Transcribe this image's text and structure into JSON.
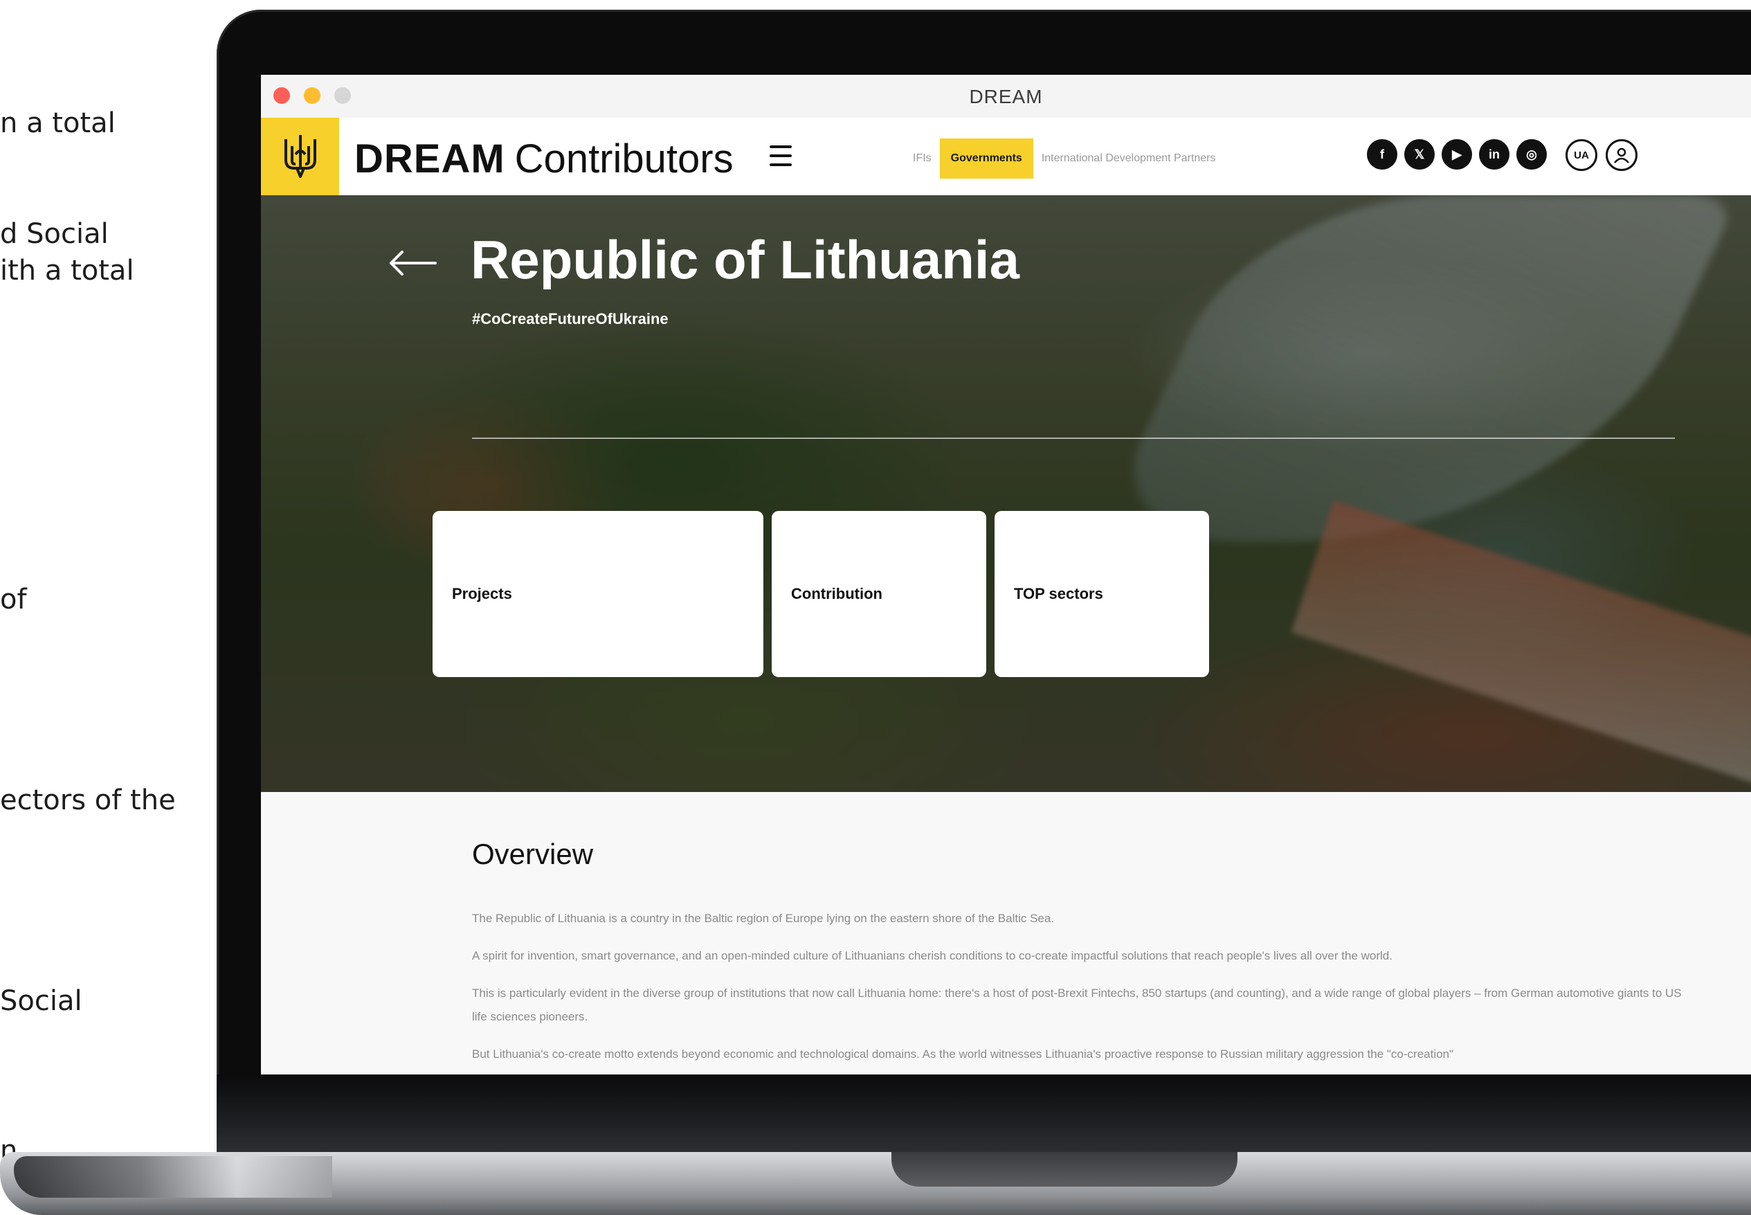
{
  "side_text": [
    {
      "text": "n a total"
    },
    {
      "text": "d Social"
    },
    {
      "text": "ith a total"
    },
    {
      "text": "of"
    },
    {
      "text": "ectors of the"
    },
    {
      "text": "Social"
    },
    {
      "text": "n"
    }
  ],
  "window": {
    "title": "DREAM"
  },
  "header": {
    "brand_bold": "DREAM",
    "brand_light": "Contributors",
    "nav": [
      {
        "label": "IFIs",
        "active": false
      },
      {
        "label": "Governments",
        "active": true
      },
      {
        "label": "International Development Partners",
        "active": false
      }
    ],
    "socials": [
      {
        "icon": "facebook-icon",
        "glyph": "f"
      },
      {
        "icon": "x-icon",
        "glyph": "𝕏"
      },
      {
        "icon": "youtube-icon",
        "glyph": "▶"
      },
      {
        "icon": "linkedin-icon",
        "glyph": "in"
      },
      {
        "icon": "instagram-icon",
        "glyph": "◎"
      }
    ],
    "lang": "UA",
    "user_icon": "user-icon"
  },
  "hero": {
    "title": "Republic of Lithuania",
    "hashtag": "#CoCreateFutureOfUkraine",
    "cards": [
      {
        "label": "Projects"
      },
      {
        "label": "Contribution"
      },
      {
        "label": "TOP sectors"
      }
    ]
  },
  "overview": {
    "title": "Overview",
    "paragraphs": [
      "The Republic of Lithuania is a country in the Baltic region of Europe lying on the eastern shore of the Baltic Sea.",
      "A spirit for invention, smart governance, and an open-minded culture of Lithuanians cherish conditions to co-create impactful solutions that reach people's lives all over the world.",
      "This is particularly evident in the diverse group of institutions that now call Lithuania home: there's a host of post-Brexit Fintechs, 850 startups (and counting), and a wide range of global players – from German automotive giants to US life sciences pioneers.",
      "But Lithuania's co-create motto extends beyond economic and technological domains. As the world witnesses Lithuania's proactive response to Russian military aggression the \"co-creation\""
    ]
  },
  "colors": {
    "accent": "#f7d02b",
    "dark": "#111111"
  }
}
